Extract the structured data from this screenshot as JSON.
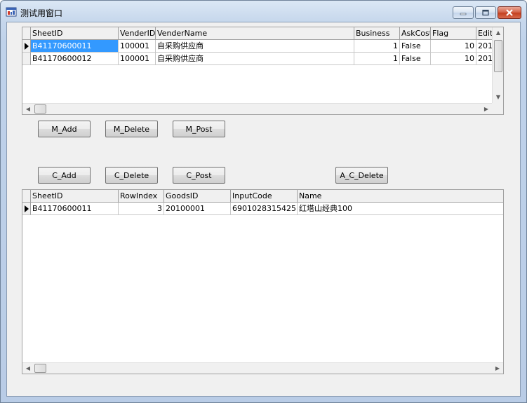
{
  "window": {
    "title": "测试用窗口"
  },
  "master_grid": {
    "columns": [
      "SheetID",
      "VenderID",
      "VenderName",
      "Business",
      "AskCost",
      "Flag",
      "Editi"
    ],
    "rows": [
      [
        "B41170600011",
        "100001",
        "自采购供应商",
        "1",
        "False",
        "10",
        "201"
      ],
      [
        "B41170600012",
        "100001",
        "自采购供应商",
        "1",
        "False",
        "10",
        "201"
      ]
    ]
  },
  "master_buttons": {
    "add": "M_Add",
    "delete": "M_Delete",
    "post": "M_Post"
  },
  "child_buttons": {
    "add": "C_Add",
    "delete": "C_Delete",
    "post": "C_Post",
    "all_delete": "A_C_Delete"
  },
  "child_grid": {
    "columns": [
      "SheetID",
      "RowIndex",
      "GoodsID",
      "InputCode",
      "Name"
    ],
    "rows": [
      [
        "B41170600011",
        "3",
        "20100001",
        "6901028315425",
        "红塔山经典100"
      ]
    ]
  },
  "colors": {
    "selection": "#3399ff",
    "close_button": "#c4401f"
  }
}
